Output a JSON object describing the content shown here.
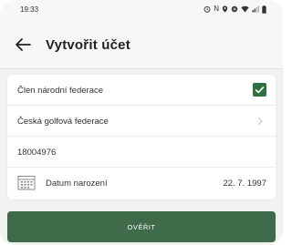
{
  "status_bar": {
    "time": "19:33",
    "icons": [
      "alarm-icon",
      "nfc-icon",
      "location-icon",
      "data-saver-icon",
      "wifi-icon",
      "signal-icon",
      "battery-icon"
    ]
  },
  "app_bar": {
    "back_icon": "arrow-left-icon",
    "title": "Vytvořit účet"
  },
  "form": {
    "member_label": "Člen národní federace",
    "member_checked": true,
    "federation_label": "Česká golfová federace",
    "member_number": "18004976",
    "birthdate_label": "Datum narození",
    "birthdate_value": "22. 7. 1997"
  },
  "verify_button": {
    "label": "OVĚŘIT"
  },
  "colors": {
    "accent": "#3f6b4b",
    "checkbox": "#2e7040",
    "background": "#f2f2f2"
  }
}
